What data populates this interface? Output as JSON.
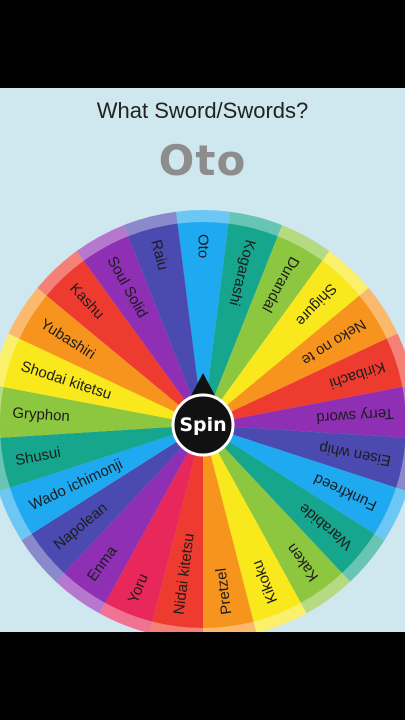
{
  "header": {
    "question": "What Sword/Swords?",
    "result": "Oto"
  },
  "wheel": {
    "spin_label": "Spin",
    "segments": [
      {
        "label": "Oto",
        "color": "#1fa9f0"
      },
      {
        "label": "Kogarashi",
        "color": "#16a58d"
      },
      {
        "label": "Durandal",
        "color": "#8dc63f"
      },
      {
        "label": "Shigure",
        "color": "#f8e81c"
      },
      {
        "label": "Neko no te",
        "color": "#f7941d"
      },
      {
        "label": "Kiribachi",
        "color": "#ee3b2f"
      },
      {
        "label": "Terry sword",
        "color": "#8e2fb4"
      },
      {
        "label": "Eisen whip",
        "color": "#4a4ab0"
      },
      {
        "label": "Funkfreed",
        "color": "#1fa9f0"
      },
      {
        "label": "Warabide",
        "color": "#16a58d"
      },
      {
        "label": "Kaken",
        "color": "#8dc63f"
      },
      {
        "label": "Kikoku",
        "color": "#f8e81c"
      },
      {
        "label": "Pretzel",
        "color": "#f7941d"
      },
      {
        "label": "Nidai kitetsu",
        "color": "#ee3b2f"
      },
      {
        "label": "Yoru",
        "color": "#e8285a"
      },
      {
        "label": "Enma",
        "color": "#8e2fb4"
      },
      {
        "label": "Napolean",
        "color": "#4a4ab0"
      },
      {
        "label": "Wado ichimonji",
        "color": "#1fa9f0"
      },
      {
        "label": "Shusui",
        "color": "#16a58d"
      },
      {
        "label": "Gryphon",
        "color": "#8dc63f"
      },
      {
        "label": "Shodai kitetsu",
        "color": "#f8e81c"
      },
      {
        "label": "Yubashiri",
        "color": "#f7941d"
      },
      {
        "label": "Kashu",
        "color": "#ee3b2f"
      },
      {
        "label": "Soul Solid",
        "color": "#8e2fb4"
      },
      {
        "label": "Raiu",
        "color": "#4a4ab0"
      }
    ]
  }
}
